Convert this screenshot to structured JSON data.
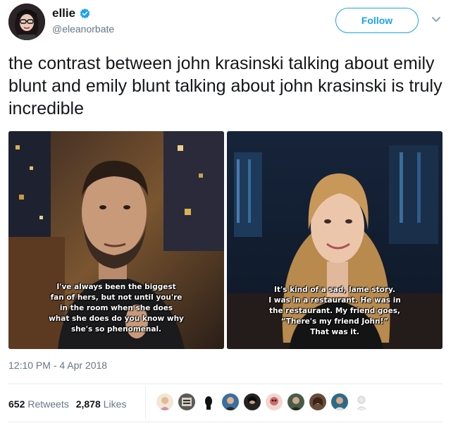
{
  "user": {
    "display_name": "ellie",
    "handle": "@eleanorbate",
    "verified": true,
    "avatar_icon": "user-avatar"
  },
  "follow_label": "Follow",
  "caret_icon": "chevron-down-icon",
  "tweet_text": "the contrast between john krasinski talking about emily blunt and emily blunt talking about john krasinski is truly incredible",
  "media": {
    "left_caption": [
      "I've always been the biggest",
      "fan of hers, but not until you're",
      "in the room when she does",
      "what she does do you know why",
      "she's so phenomenal."
    ],
    "right_caption": [
      "It's kind of a sad, lame story.",
      "I was in a restaurant. He was in",
      "the restaurant. My friend goes,",
      "“There's my friend John!”",
      "That was it."
    ]
  },
  "timestamp": "12:10 PM - 4 Apr 2018",
  "stats": {
    "retweets_count": "652",
    "retweets_label": "Retweets",
    "likes_count": "2,878",
    "likes_label": "Likes"
  },
  "colors": {
    "accent": "#1da1f2",
    "secondary_text": "#657786",
    "divider": "#e6ecf0"
  }
}
